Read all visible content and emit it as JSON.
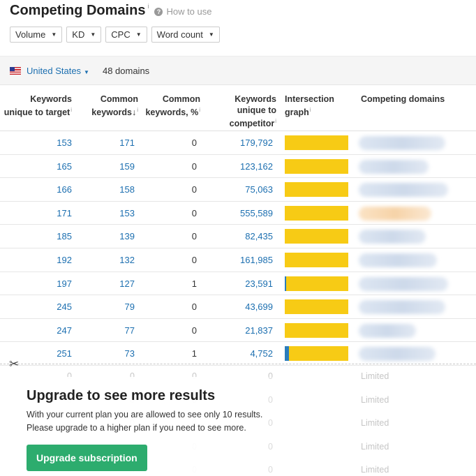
{
  "header": {
    "title": "Competing Domains",
    "info": "i",
    "help_icon": "?",
    "how_to": "How to use"
  },
  "filters": [
    {
      "label": "Volume"
    },
    {
      "label": "KD"
    },
    {
      "label": "CPC"
    },
    {
      "label": "Word count"
    }
  ],
  "country_bar": {
    "country": "United States",
    "domains_count": "48 domains"
  },
  "columns": {
    "unique_target": [
      "Keywords",
      "unique to target"
    ],
    "common": [
      "Common",
      "keywords↓"
    ],
    "common_pct": [
      "Common",
      "keywords, %"
    ],
    "unique_competitor": [
      "Keywords",
      "unique to",
      "competitor"
    ],
    "intersection": [
      "Intersection",
      "graph"
    ],
    "competing": [
      "Competing domains"
    ]
  },
  "rows": [
    {
      "unique_target": "153",
      "common": "171",
      "common_pct": "0",
      "unique_competitor": "179,792",
      "intersection_share": 0.0,
      "domain_tint": "#cfd9ea"
    },
    {
      "unique_target": "165",
      "common": "159",
      "common_pct": "0",
      "unique_competitor": "123,162",
      "intersection_share": 0.0,
      "domain_tint": "#cfd9ea"
    },
    {
      "unique_target": "166",
      "common": "158",
      "common_pct": "0",
      "unique_competitor": "75,063",
      "intersection_share": 0.0,
      "domain_tint": "#cfd9ea"
    },
    {
      "unique_target": "171",
      "common": "153",
      "common_pct": "0",
      "unique_competitor": "555,589",
      "intersection_share": 0.0,
      "domain_tint": "#f6d3a8"
    },
    {
      "unique_target": "185",
      "common": "139",
      "common_pct": "0",
      "unique_competitor": "82,435",
      "intersection_share": 0.0,
      "domain_tint": "#cfd9ea"
    },
    {
      "unique_target": "192",
      "common": "132",
      "common_pct": "0",
      "unique_competitor": "161,985",
      "intersection_share": 0.0,
      "domain_tint": "#cfd9ea"
    },
    {
      "unique_target": "197",
      "common": "127",
      "common_pct": "1",
      "unique_competitor": "23,591",
      "intersection_share": 0.02,
      "domain_tint": "#cfd9ea"
    },
    {
      "unique_target": "245",
      "common": "79",
      "common_pct": "0",
      "unique_competitor": "43,699",
      "intersection_share": 0.0,
      "domain_tint": "#cfd9ea"
    },
    {
      "unique_target": "247",
      "common": "77",
      "common_pct": "0",
      "unique_competitor": "21,837",
      "intersection_share": 0.0,
      "domain_tint": "#cfd9ea"
    },
    {
      "unique_target": "251",
      "common": "73",
      "common_pct": "1",
      "unique_competitor": "4,752",
      "intersection_share": 0.07,
      "domain_tint": "#cfd9ea"
    }
  ],
  "limited_rows": [
    {
      "v1": "0",
      "v2": "0",
      "v3": "0",
      "v4": "0",
      "label": "Limited"
    },
    {
      "v1": "0",
      "v2": "0",
      "v3": "0",
      "v4": "0",
      "label": "Limited"
    },
    {
      "v1": "0",
      "v2": "0",
      "v3": "0",
      "v4": "0",
      "label": "Limited"
    },
    {
      "v1": "0",
      "v2": "0",
      "v3": "0",
      "v4": "0",
      "label": "Limited"
    },
    {
      "v1": "0",
      "v2": "0",
      "v3": "0",
      "v4": "0",
      "label": "Limited"
    }
  ],
  "upgrade": {
    "title": "Upgrade to see more results",
    "line1": "With your current plan you are allowed to see only 10 results.",
    "line2": "Please upgrade to a higher plan if you need to see more.",
    "button": "Upgrade subscription"
  },
  "colors": {
    "link": "#1c6fb0",
    "graph_bar": "#f7cb15",
    "graph_common": "#2b7dbc",
    "button": "#2dac6e"
  }
}
